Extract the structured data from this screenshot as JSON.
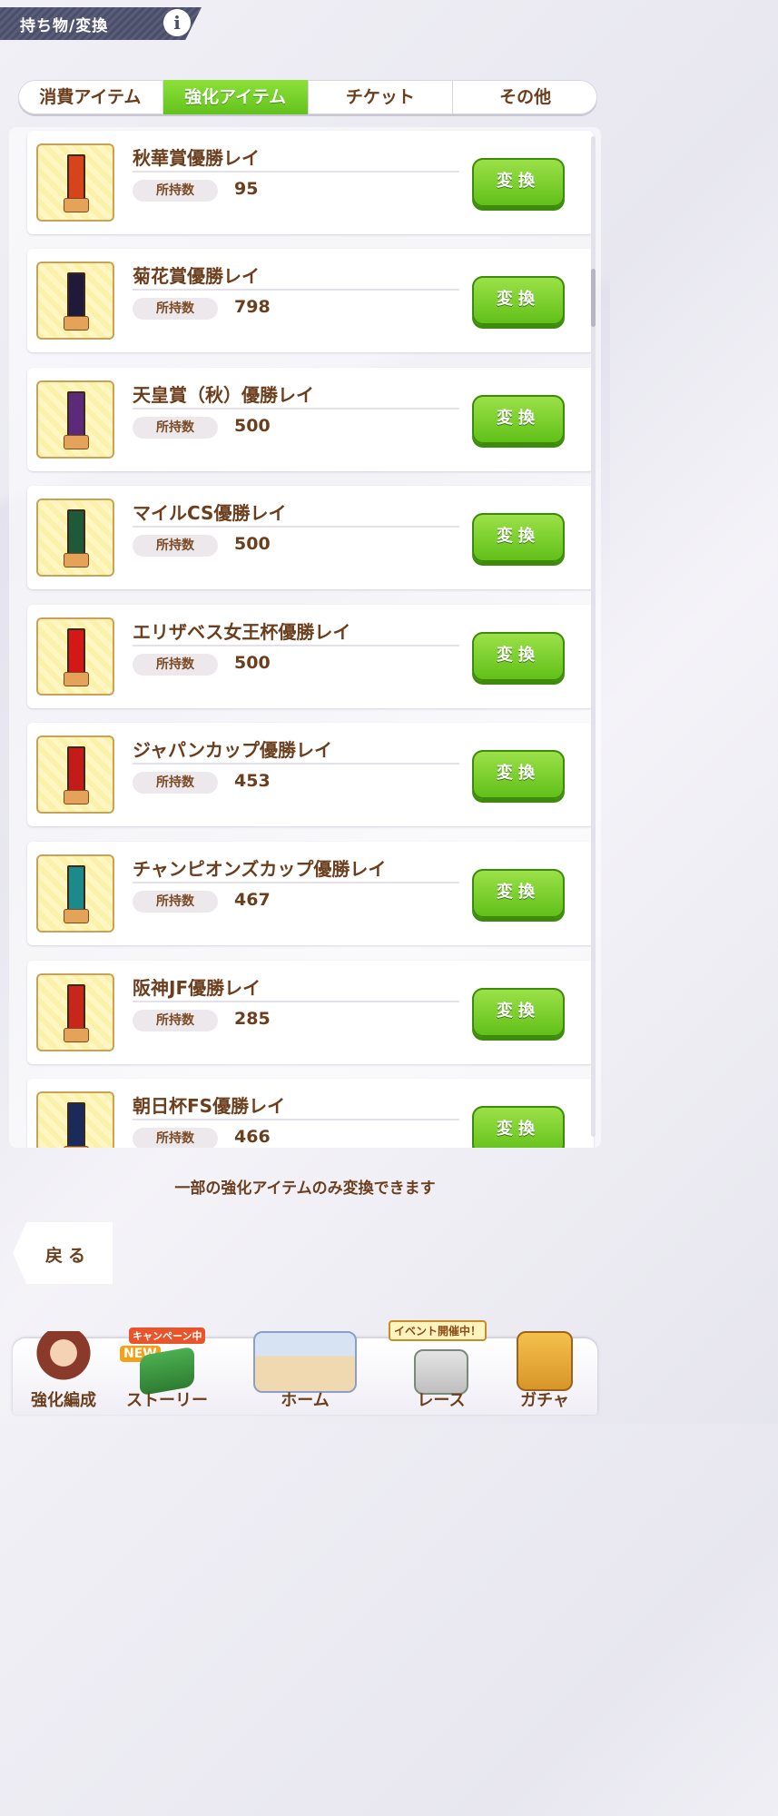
{
  "header": {
    "title": "持ち物/変換",
    "info_icon": "i"
  },
  "tabs": [
    {
      "label": "消費アイテム",
      "active": false
    },
    {
      "label": "強化アイテム",
      "active": true
    },
    {
      "label": "チケット",
      "active": false
    },
    {
      "label": "その他",
      "active": false
    }
  ],
  "items": [
    {
      "name": "秋華賞優勝レイ",
      "owned_label": "所持数",
      "owned": "95",
      "button": "変換",
      "lei_color": "#d6431d"
    },
    {
      "name": "菊花賞優勝レイ",
      "owned_label": "所持数",
      "owned": "798",
      "button": "変換",
      "lei_color": "#1f1a3a"
    },
    {
      "name": "天皇賞（秋）優勝レイ",
      "owned_label": "所持数",
      "owned": "500",
      "button": "変換",
      "lei_color": "#5b2a7a"
    },
    {
      "name": "マイルCS優勝レイ",
      "owned_label": "所持数",
      "owned": "500",
      "button": "変換",
      "lei_color": "#1e5a3a"
    },
    {
      "name": "エリザベス女王杯優勝レイ",
      "owned_label": "所持数",
      "owned": "500",
      "button": "変換",
      "lei_color": "#d41818"
    },
    {
      "name": "ジャパンカップ優勝レイ",
      "owned_label": "所持数",
      "owned": "453",
      "button": "変換",
      "lei_color": "#c41a1a"
    },
    {
      "name": "チャンピオンズカップ優勝レイ",
      "owned_label": "所持数",
      "owned": "467",
      "button": "変換",
      "lei_color": "#1a8a8a"
    },
    {
      "name": "阪神JF優勝レイ",
      "owned_label": "所持数",
      "owned": "285",
      "button": "変換",
      "lei_color": "#c8261a"
    },
    {
      "name": "朝日杯FS優勝レイ",
      "owned_label": "所持数",
      "owned": "466",
      "button": "変換",
      "lei_color": "#1a2a5a"
    }
  ],
  "footer_note": "一部の強化アイテムのみ変換できます",
  "back_button": "戻る",
  "bottom_nav": [
    {
      "label": "強化編成",
      "badge": ""
    },
    {
      "label": "ストーリー",
      "badge": "キャンペーン中",
      "badge2": "NEW"
    },
    {
      "label": "ホーム",
      "badge": ""
    },
    {
      "label": "レース",
      "badge": "イベント開催中！"
    },
    {
      "label": "ガチャ",
      "badge": ""
    }
  ]
}
